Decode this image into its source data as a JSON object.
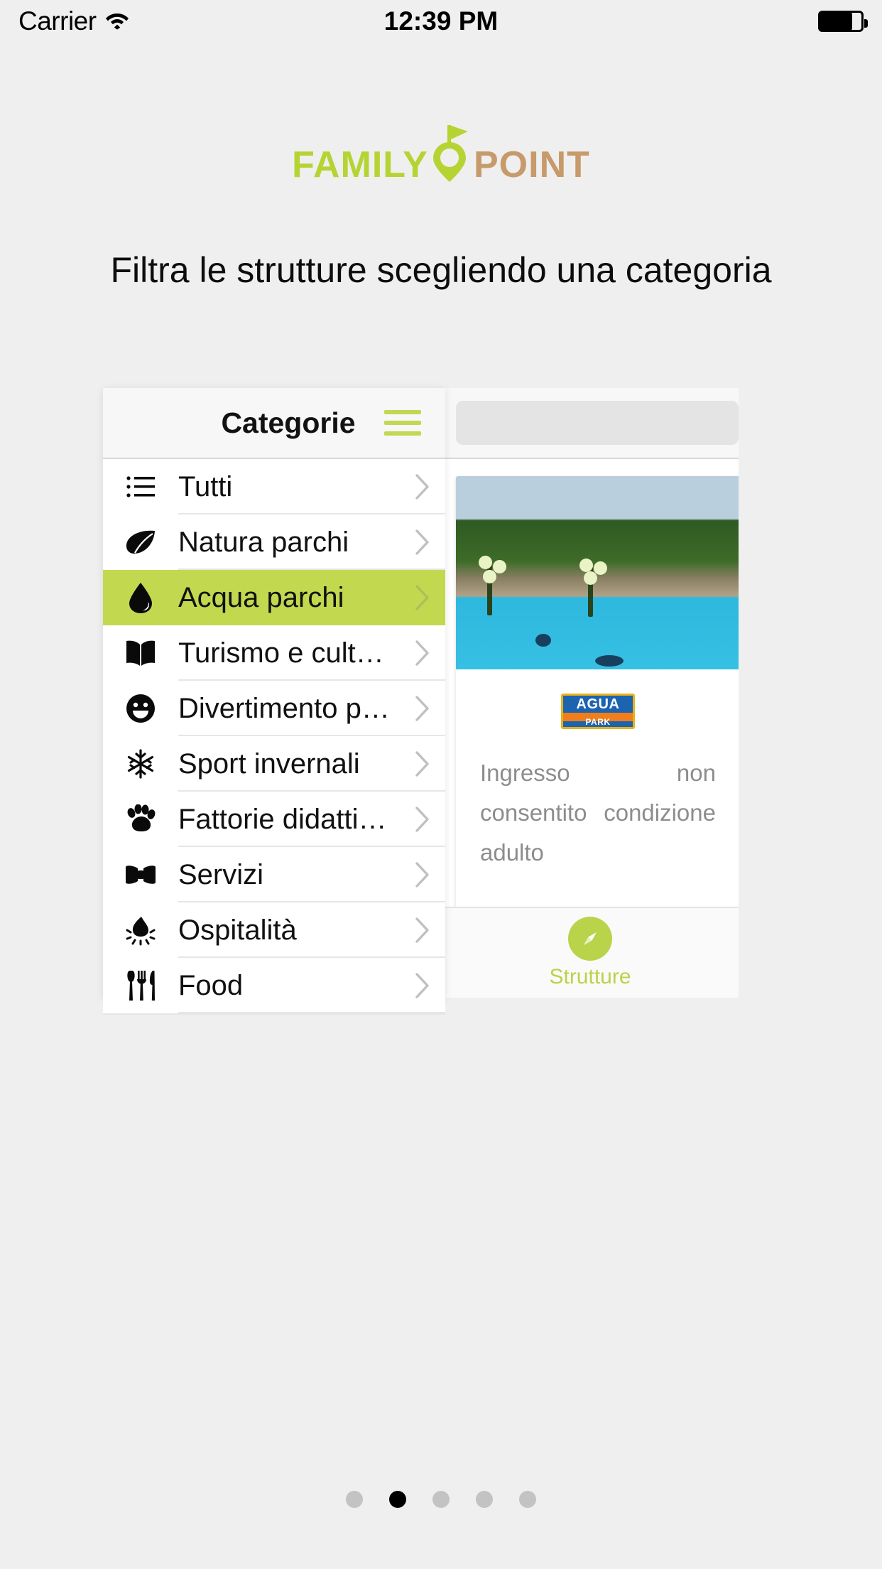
{
  "statusbar": {
    "carrier": "Carrier",
    "wifi_icon": "wifi-icon",
    "time": "12:39 PM",
    "battery_icon": "battery-icon",
    "battery_level_pct": 78
  },
  "logo": {
    "text_primary": "FAMILY",
    "text_secondary": "POINT",
    "pin_icon": "map-pin-flag-icon",
    "color_primary": "#b5d433",
    "color_secondary": "#c79a6b"
  },
  "heading": {
    "text": "Filtra le strutture scegliendo una categoria"
  },
  "panel": {
    "title": "Categorie",
    "menu_icon": "hamburger-menu-icon",
    "menu_color": "#c2d752",
    "highlight_color": "#c2d94f",
    "categories": [
      {
        "label": "Tutti",
        "icon": "list-icon",
        "glyph": "☰",
        "selected": false
      },
      {
        "label": "Natura parchi",
        "icon": "leaf-icon",
        "glyph": "❧",
        "selected": false
      },
      {
        "label": "Acqua parchi",
        "icon": "water-drop-icon",
        "glyph": "●",
        "selected": true
      },
      {
        "label": "Turismo e cultura",
        "icon": "open-book-icon",
        "glyph": "‖",
        "selected": false
      },
      {
        "label": "Divertimento parchi",
        "icon": "smiley-face-icon",
        "glyph": "☻",
        "selected": false
      },
      {
        "label": "Sport invernali",
        "icon": "snowflake-icon",
        "glyph": "❄",
        "selected": false
      },
      {
        "label": "Fattorie didattiche e mane…",
        "icon": "paw-print-icon",
        "glyph": "✿",
        "selected": false
      },
      {
        "label": "Servizi",
        "icon": "bow-tie-icon",
        "glyph": "⧓",
        "selected": false
      },
      {
        "label": "Ospitalità",
        "icon": "campfire-icon",
        "glyph": "♨",
        "selected": false
      },
      {
        "label": "Food",
        "icon": "cutlery-icon",
        "glyph": "ἷ4",
        "selected": false
      }
    ],
    "chevron_icon": "chevron-right-icon"
  },
  "background_panel": {
    "search_placeholder": "",
    "card": {
      "photo_alt": "pool-photo",
      "brand_logo": {
        "line1": "AGUA",
        "line2": "PARK"
      },
      "description": "Ingresso non consentito condizione adulto",
      "payment_icon": "credit-card-icon"
    },
    "second_photo_alt": "waterslide-photo",
    "tabbar": {
      "icon": "compass-icon",
      "label": "Strutture",
      "color": "#b9d34a"
    }
  },
  "page_dots": {
    "total": 5,
    "active_index": 1
  }
}
